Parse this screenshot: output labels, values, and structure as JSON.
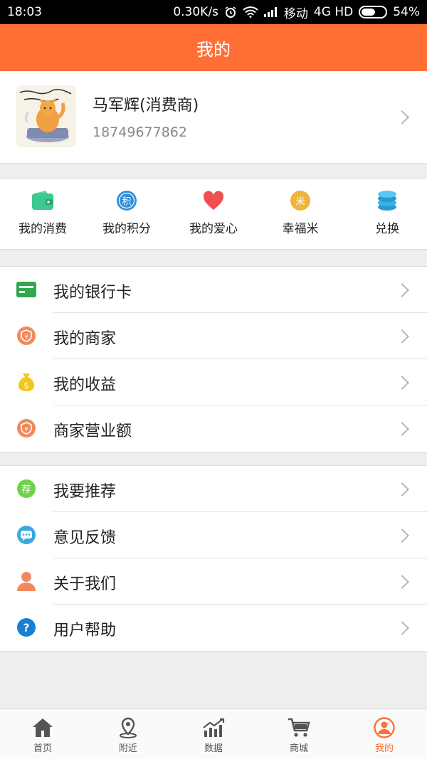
{
  "status": {
    "time": "18:03",
    "speed": "0.30K/s",
    "carrier": "移动",
    "network": "4G HD",
    "battery": "54%"
  },
  "header": {
    "title": "我的"
  },
  "profile": {
    "name": "马军辉(消费商)",
    "phone": "18749677862"
  },
  "quick": [
    {
      "label": "我的消费",
      "icon": "wallet-icon",
      "color": "#3cc890"
    },
    {
      "label": "我的积分",
      "icon": "points-icon",
      "color": "#2e8fe0"
    },
    {
      "label": "我的爱心",
      "icon": "heart-icon",
      "color": "#f05050"
    },
    {
      "label": "幸福米",
      "icon": "rice-icon",
      "color": "#f0b43c"
    },
    {
      "label": "兑换",
      "icon": "coins-icon",
      "color": "#36b0e6"
    }
  ],
  "menu1": [
    {
      "label": "我的银行卡",
      "icon": "bank-card-icon"
    },
    {
      "label": "我的商家",
      "icon": "merchant-icon"
    },
    {
      "label": "我的收益",
      "icon": "money-bag-icon"
    },
    {
      "label": "商家营业额",
      "icon": "turnover-icon"
    }
  ],
  "menu2": [
    {
      "label": "我要推荐",
      "icon": "recommend-icon",
      "badge": "荐"
    },
    {
      "label": "意见反馈",
      "icon": "feedback-icon"
    },
    {
      "label": "关于我们",
      "icon": "person-icon"
    },
    {
      "label": "用户帮助",
      "icon": "help-icon"
    }
  ],
  "tabs": [
    {
      "label": "首页",
      "icon": "home-icon"
    },
    {
      "label": "附近",
      "icon": "location-icon"
    },
    {
      "label": "数据",
      "icon": "chart-icon"
    },
    {
      "label": "商城",
      "icon": "cart-icon"
    },
    {
      "label": "我的",
      "icon": "user-icon"
    }
  ],
  "colors": {
    "accent": "#ff6f35"
  }
}
